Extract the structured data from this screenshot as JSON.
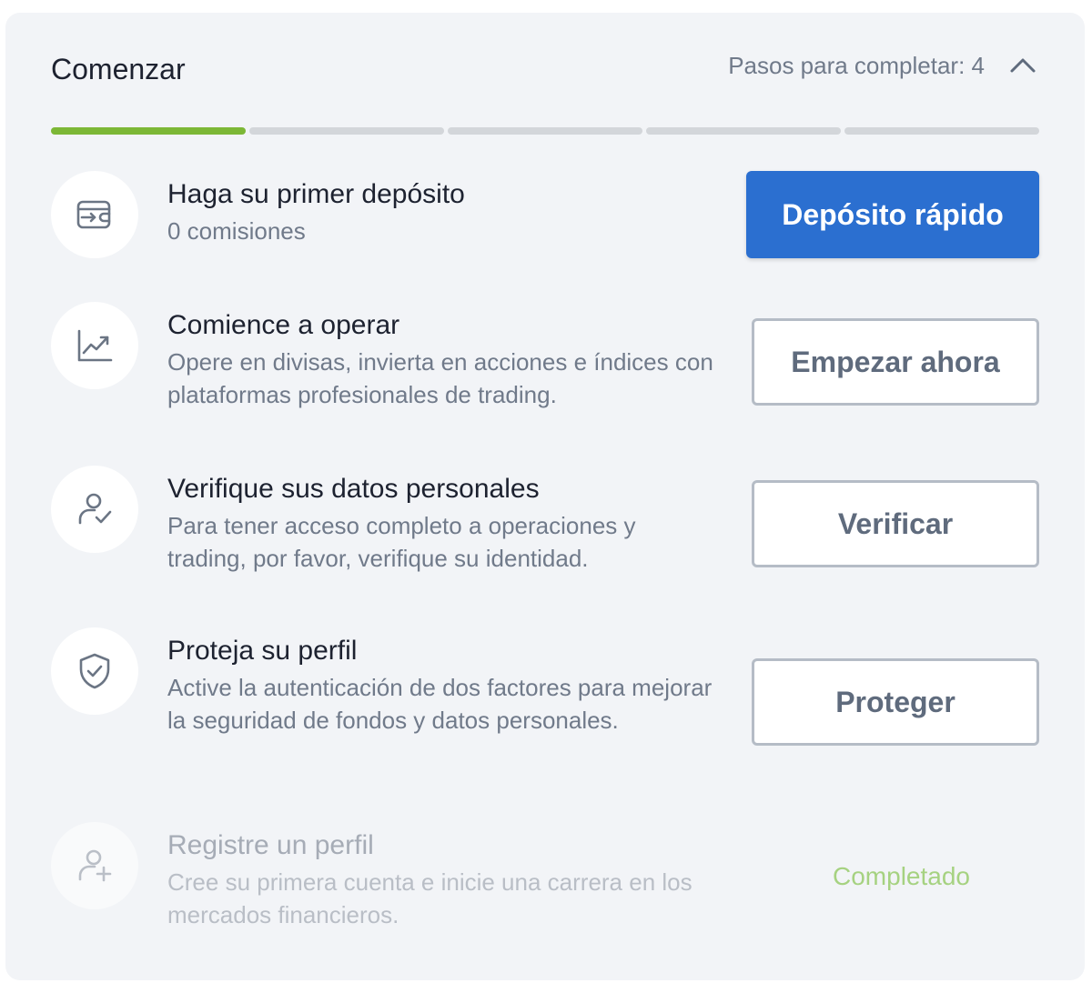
{
  "header": {
    "title": "Comenzar",
    "steps_remaining": "Pasos para completar: 4",
    "collapse_icon": "chevron-up-icon"
  },
  "progress": {
    "total_steps": 5,
    "completed_steps": 1,
    "completed_color": "#7cb736",
    "pending_color": "#d3d6da"
  },
  "steps": [
    {
      "icon": "wallet-transfer-icon",
      "title": "Haga su primer depósito",
      "description": "0 comisiones",
      "button": "Depósito rápido"
    },
    {
      "icon": "chart-trend-icon",
      "title": "Comience a operar",
      "description": "Opere en divisas, invierta en acciones e índices con plataformas profesionales de trading.",
      "button": "Empezar ahora"
    },
    {
      "icon": "user-check-icon",
      "title": "Verifique sus datos personales",
      "description": "Para tener acceso completo a operaciones y trading, por favor, verifique su identidad.",
      "button": "Verificar"
    },
    {
      "icon": "shield-check-icon",
      "title": "Proteja su perfil",
      "description": "Active la autenticación de dos factores para mejorar la seguridad de fondos y datos personales.",
      "button": "Proteger"
    },
    {
      "icon": "user-add-icon",
      "title": "Registre un perfil",
      "description": "Cree su primera cuenta e inicie una carrera en los mercados financieros.",
      "status": "Completado"
    }
  ],
  "colors": {
    "primary_button": "#2b6fd0",
    "completed_text": "#a6d281"
  }
}
